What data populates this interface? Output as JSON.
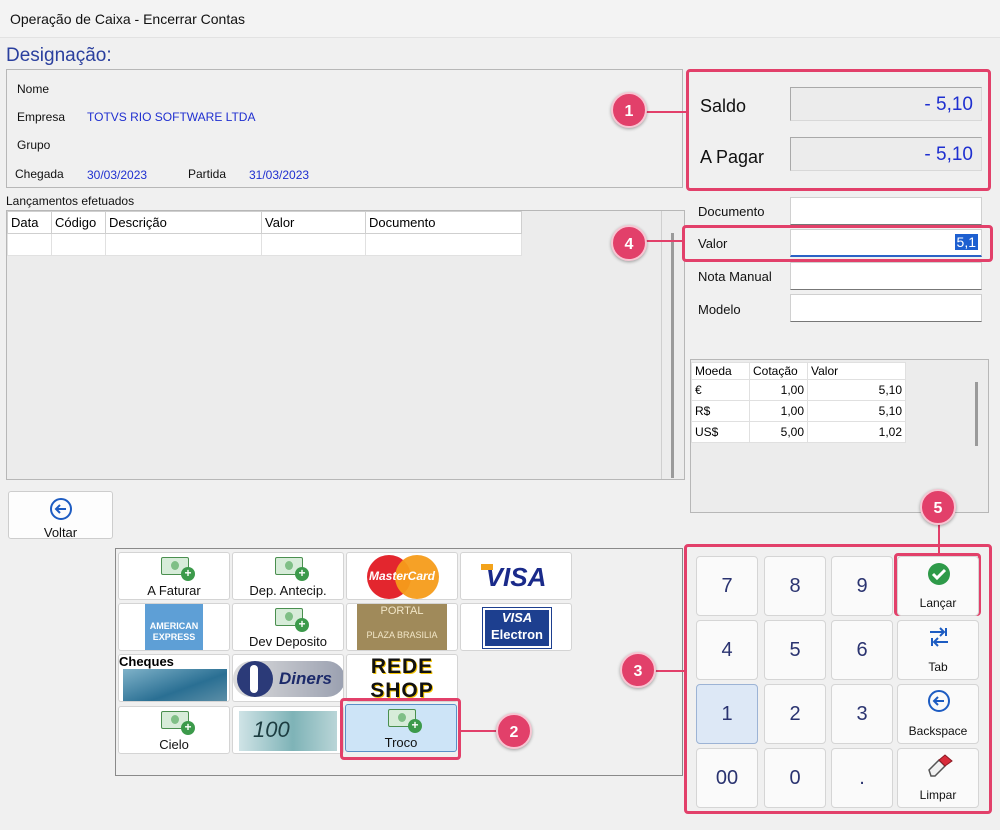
{
  "window": {
    "title": "Operação de Caixa - Encerrar Contas"
  },
  "designacao": "Designação:",
  "info": {
    "nome_label": "Nome",
    "empresa_label": "Empresa",
    "empresa_value": "TOTVS RIO SOFTWARE LTDA",
    "grupo_label": "Grupo",
    "chegada_label": "Chegada",
    "chegada_value": "30/03/2023",
    "partida_label": "Partida",
    "partida_value": "31/03/2023"
  },
  "totals": {
    "saldo_label": "Saldo",
    "saldo_value": "- 5,10",
    "apagar_label": "A Pagar",
    "apagar_value": "- 5,10"
  },
  "lancamentos": {
    "title": "Lançamentos efetuados",
    "columns": [
      "Data",
      "Código",
      "Descrição",
      "Valor",
      "Documento"
    ]
  },
  "form": {
    "documento_label": "Documento",
    "valor_label": "Valor",
    "valor_value": "5,1",
    "nota_label": "Nota Manual",
    "modelo_label": "Modelo"
  },
  "moedas": {
    "columns": [
      "Moeda",
      "Cotação",
      "Valor"
    ],
    "rows": [
      [
        "€",
        "1,00",
        "5,10"
      ],
      [
        "R$",
        "1,00",
        "5,10"
      ],
      [
        "US$",
        "5,00",
        "1,02"
      ]
    ]
  },
  "voltar_label": "Voltar",
  "payments": {
    "a_faturar": "A Faturar",
    "dep_antecip": "Dep. Antecip.",
    "mastercard": "MasterCard",
    "visa": "VISA",
    "amex_line1": "AMERICAN",
    "amex_line2": "EXPRESS",
    "dev_deposito": "Dev Deposito",
    "portal_line1": "PORTAL",
    "portal_line2": "PLAZA BRASILIA",
    "visa_electron_line1": "VISA",
    "visa_electron_line2": "Electron",
    "cheques": "Cheques",
    "diners": "Diners",
    "rede_line1": "REDE",
    "rede_line2": "SHOP",
    "cielo": "Cielo",
    "note_value": "100",
    "troco": "Troco"
  },
  "keypad": {
    "keys": [
      "7",
      "8",
      "9",
      "4",
      "5",
      "6",
      "1",
      "2",
      "3",
      "00",
      "0",
      "."
    ],
    "lancar": "Lançar",
    "tab": "Tab",
    "backspace": "Backspace",
    "limpar": "Limpar"
  },
  "markers": [
    "1",
    "2",
    "3",
    "4",
    "5"
  ],
  "colors": {
    "accent": "#e2406a",
    "value_blue": "#1f2fd0",
    "title_blue": "#2a3f9e"
  }
}
